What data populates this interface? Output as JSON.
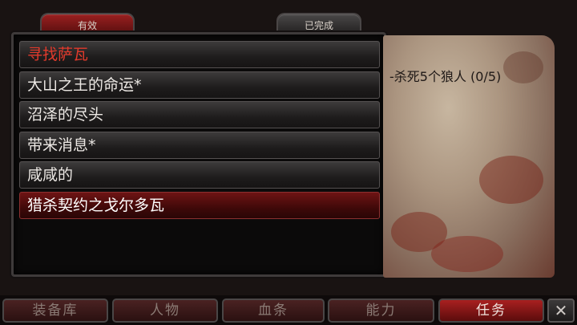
{
  "tabs": {
    "active": "有效",
    "completed": "已完成"
  },
  "quests": [
    {
      "label": "寻找萨瓦",
      "state": "tracked"
    },
    {
      "label": "大山之王的命运*",
      "state": "normal"
    },
    {
      "label": "沼泽的尽头",
      "state": "normal"
    },
    {
      "label": "带来消息*",
      "state": "normal"
    },
    {
      "label": "咸咸的",
      "state": "normal"
    },
    {
      "label": "猎杀契约之戈尔多瓦",
      "state": "selected"
    }
  ],
  "objective": "-杀死5个狼人 (0/5)",
  "bottom_tabs": {
    "inventory": "装备库",
    "character": "人物",
    "blood": "血条",
    "skills": "能力",
    "quests": "任务"
  },
  "close_icon": "close-icon",
  "colors": {
    "tracked_quest": "#e03a2c",
    "accent_red": "#a82020",
    "panel_bg": "#0b0a0a"
  }
}
